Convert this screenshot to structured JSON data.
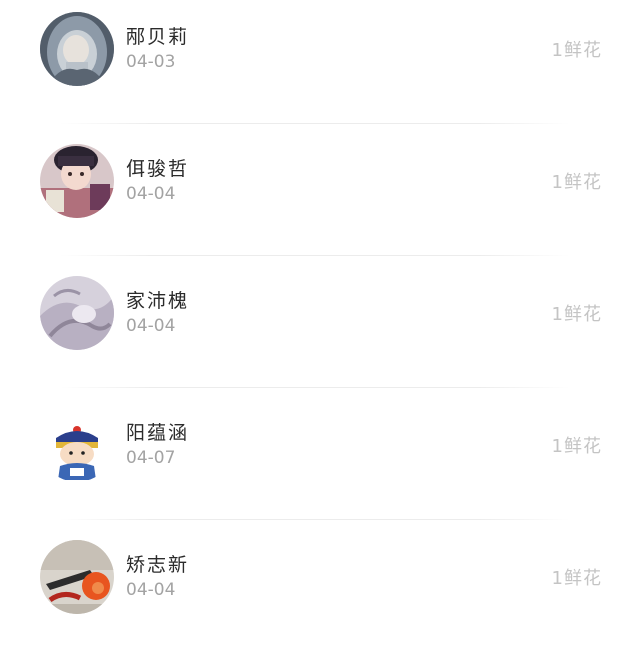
{
  "gift_list": {
    "items": [
      {
        "name": "邴贝莉",
        "date": "04-03",
        "gift": "1鲜花",
        "avatar_icon": "hooded-person-avatar"
      },
      {
        "name": "佴骏哲",
        "date": "04-04",
        "gift": "1鲜花",
        "avatar_icon": "child-portrait-avatar"
      },
      {
        "name": "家沛槐",
        "date": "04-04",
        "gift": "1鲜花",
        "avatar_icon": "muted-sketch-avatar"
      },
      {
        "name": "阳蕴涵",
        "date": "04-07",
        "gift": "1鲜花",
        "avatar_icon": "cartoon-qing-official-avatar"
      },
      {
        "name": "矫志新",
        "date": "04-04",
        "gift": "1鲜花",
        "avatar_icon": "orange-tools-avatar"
      }
    ]
  }
}
